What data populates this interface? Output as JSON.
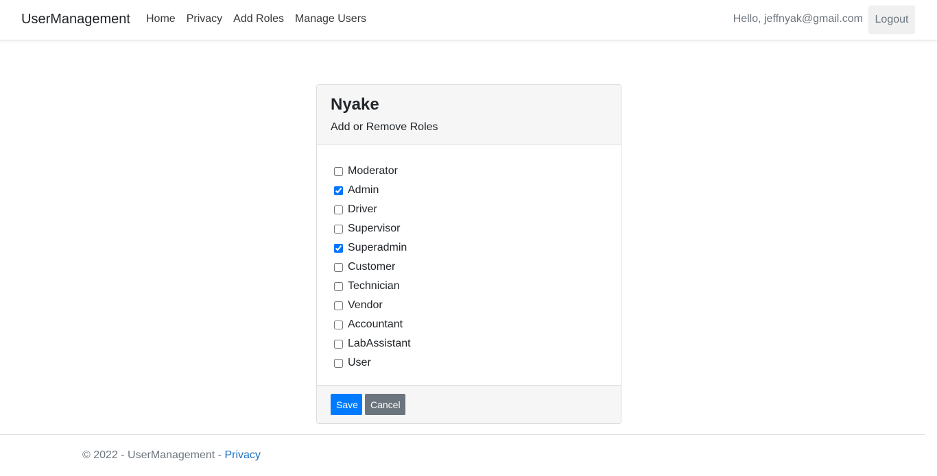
{
  "navbar": {
    "brand": "UserManagement",
    "links": [
      "Home",
      "Privacy",
      "Add Roles",
      "Manage Users"
    ],
    "greeting": "Hello, jeffnyak@gmail.com",
    "logout_label": "Logout"
  },
  "card": {
    "title": "Nyake",
    "subtitle": "Add or Remove Roles",
    "roles": [
      {
        "label": "Moderator",
        "checked": false
      },
      {
        "label": "Admin",
        "checked": true
      },
      {
        "label": "Driver",
        "checked": false
      },
      {
        "label": "Supervisor",
        "checked": false
      },
      {
        "label": "Superadmin",
        "checked": true
      },
      {
        "label": "Customer",
        "checked": false
      },
      {
        "label": "Technician",
        "checked": false
      },
      {
        "label": "Vendor",
        "checked": false
      },
      {
        "label": "Accountant",
        "checked": false
      },
      {
        "label": "LabAssistant",
        "checked": false
      },
      {
        "label": "User",
        "checked": false
      }
    ],
    "save_label": "Save",
    "cancel_label": "Cancel"
  },
  "footer": {
    "text": "© 2022 - UserManagement - ",
    "link_label": "Privacy"
  },
  "colors": {
    "primary": "#007bff",
    "secondary": "#6c757d",
    "link": "#1b6ec2"
  }
}
